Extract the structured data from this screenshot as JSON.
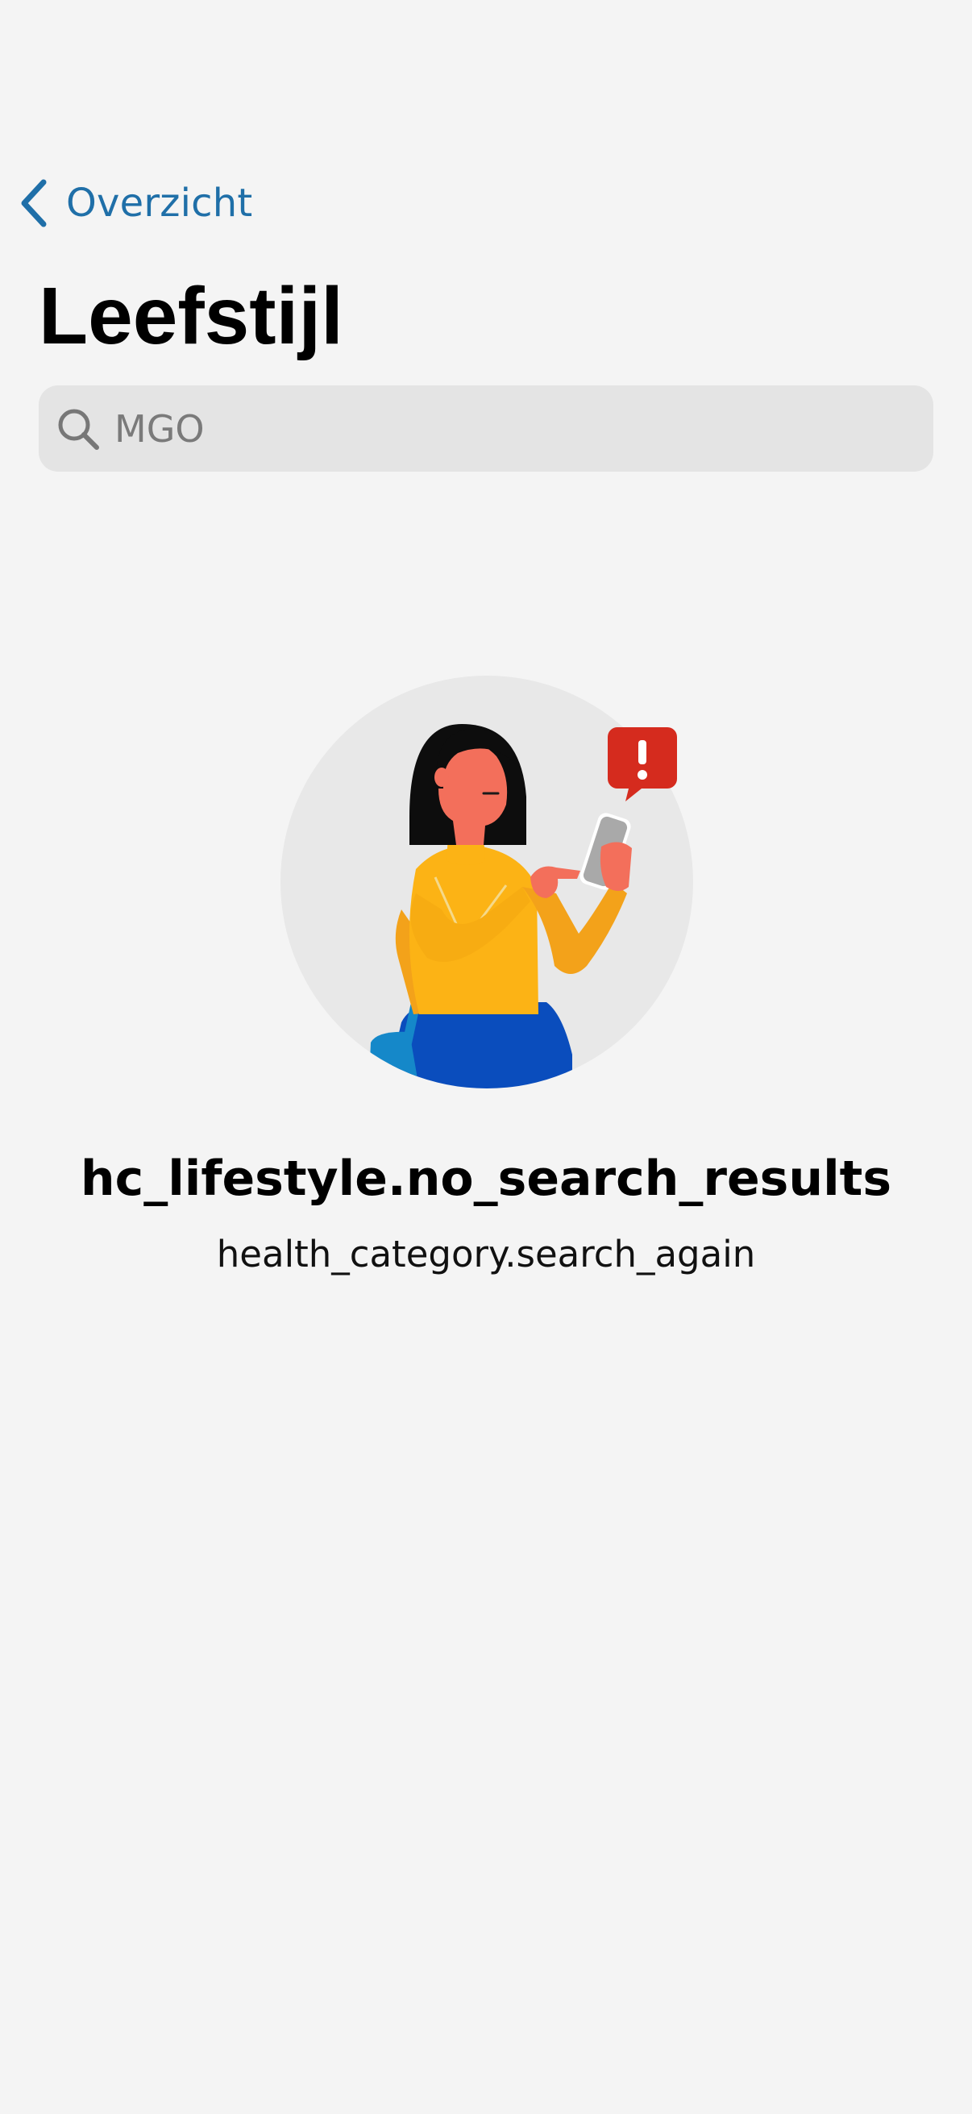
{
  "nav": {
    "back_label": "Overzicht",
    "back_icon": "chevron-left-icon",
    "accent_color": "#1f6fa8"
  },
  "header": {
    "title": "Leefstijl"
  },
  "search": {
    "placeholder": "MGO",
    "value": "",
    "icon": "search-icon"
  },
  "empty_state": {
    "illustration": "woman-with-phone-alert-illustration",
    "title": "hc_lifestyle.no_search_results",
    "subtitle": "health_category.search_again",
    "alert_color": "#d52b1e"
  }
}
